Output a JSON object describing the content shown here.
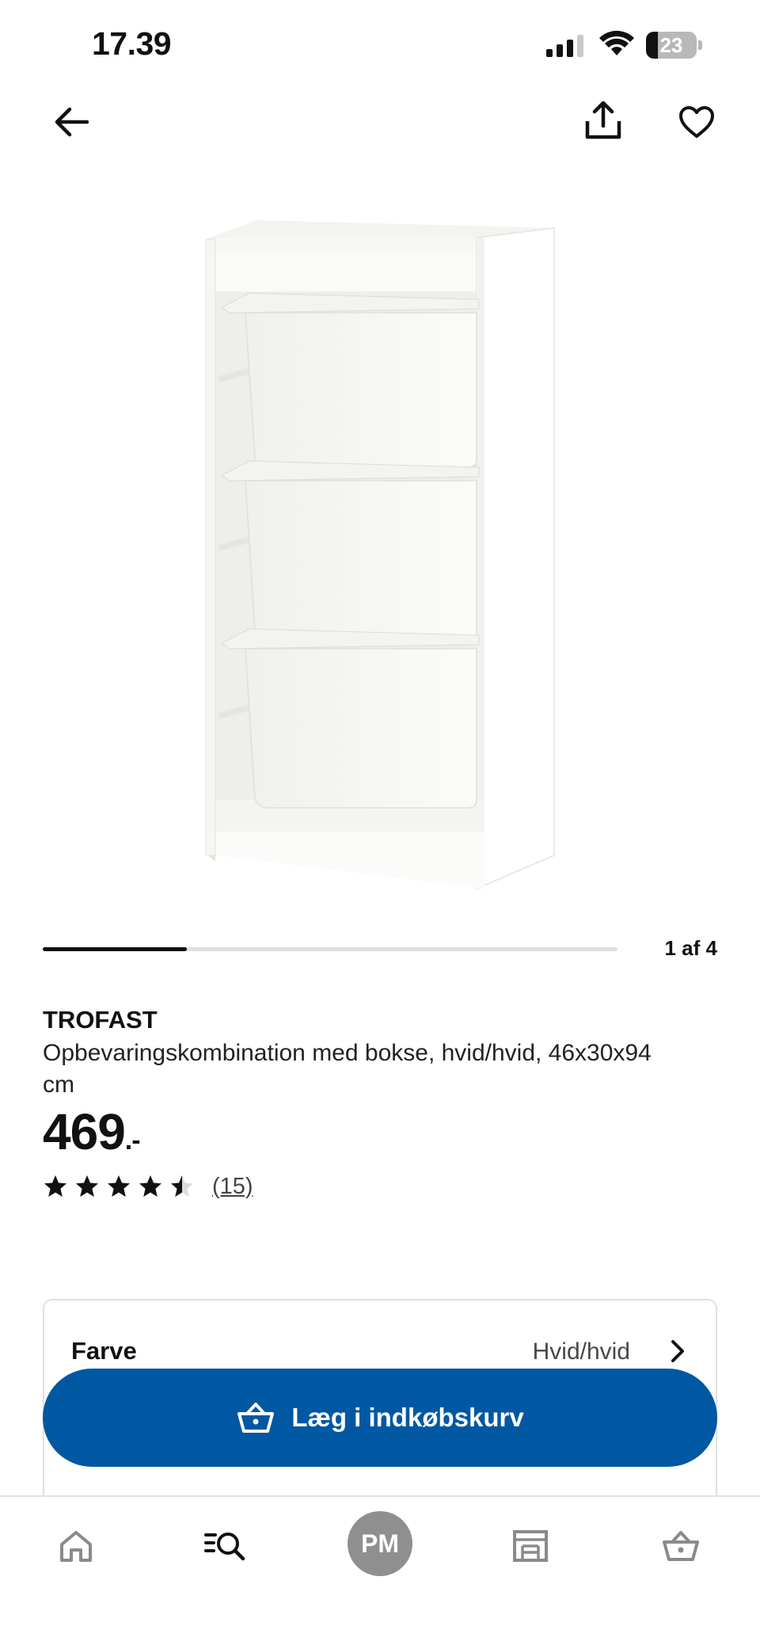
{
  "status_bar": {
    "time": "17.39",
    "battery_level": "23",
    "battery_fraction": 0.23
  },
  "top_nav": {
    "back_icon": "arrow-left-icon",
    "share_icon": "share-icon",
    "favorite_icon": "heart-icon"
  },
  "gallery": {
    "counter": "1 af 4",
    "current": 1,
    "total": 4
  },
  "product": {
    "name": "TROFAST",
    "description": "Opbevaringskombination med bokse, hvid/hvid, 46x30x94 cm",
    "price": "469",
    "price_suffix": ".-",
    "rating": 4.5,
    "rating_max": 5,
    "review_count": "(15)"
  },
  "options": {
    "color_label": "Farve",
    "color_value": "Hvid/hvid"
  },
  "cta": {
    "label": "Læg i indkøbskurv",
    "icon": "basket-icon",
    "color": "#0058a3"
  },
  "bottom_nav": {
    "items": [
      {
        "icon": "home-icon"
      },
      {
        "icon": "search-list-icon"
      },
      {
        "icon": "profile-avatar",
        "initials": "PM"
      },
      {
        "icon": "store-icon"
      },
      {
        "icon": "basket-icon"
      }
    ]
  }
}
